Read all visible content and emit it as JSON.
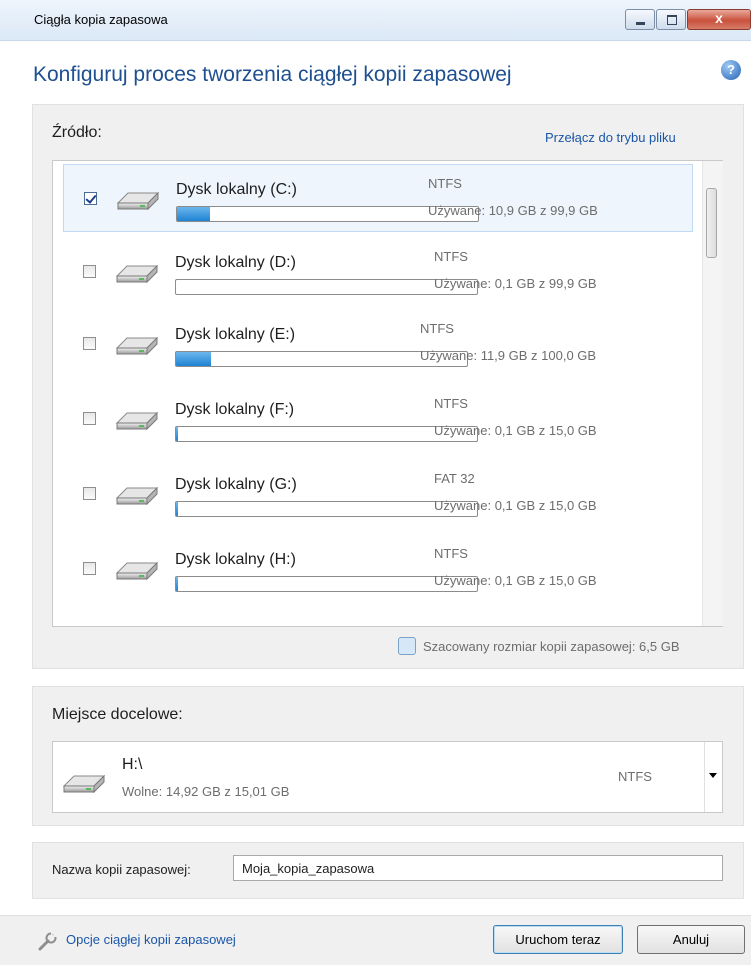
{
  "window": {
    "title": "Ciągła kopia zapasowa",
    "close_glyph": "x"
  },
  "heading": "Konfiguruj proces tworzenia ciągłej kopii zapasowej",
  "help_glyph": "?",
  "source": {
    "label": "Źródło:",
    "switch_link": "Przełącz do trybu pliku",
    "disks": [
      {
        "name": "Dysk lokalny (C:)",
        "fs": "NTFS",
        "used": "Używane: 10,9 GB z 99,9 GB",
        "checked": true,
        "usage": 0.109
      },
      {
        "name": "Dysk lokalny (D:)",
        "fs": "NTFS",
        "used": "Używane: 0,1 GB z 99,9 GB",
        "checked": false,
        "usage": 0.001
      },
      {
        "name": "Dysk lokalny (E:)",
        "fs": "NTFS",
        "used": "Używane: 11,9 GB z 100,0 GB",
        "checked": false,
        "usage": 0.119
      },
      {
        "name": "Dysk lokalny (F:)",
        "fs": "NTFS",
        "used": "Używane: 0,1 GB z 15,0 GB",
        "checked": false,
        "usage": 0.007
      },
      {
        "name": "Dysk lokalny (G:)",
        "fs": "FAT 32",
        "used": "Używane: 0,1 GB z 15,0 GB",
        "checked": false,
        "usage": 0.007
      },
      {
        "name": "Dysk lokalny (H:)",
        "fs": "NTFS",
        "used": "Używane: 0,1 GB z 15,0 GB",
        "checked": false,
        "usage": 0.007
      }
    ],
    "estimated_size": "Szacowany rozmiar kopii zapasowej: 6,5 GB"
  },
  "destination": {
    "label": "Miejsce docelowe:",
    "drive": "H:\\",
    "free": "Wolne: 14,92 GB z 15,01 GB",
    "fs": "NTFS"
  },
  "backup_name": {
    "label": "Nazwa kopii zapasowej:",
    "value": "Moja_kopia_zapasowa"
  },
  "footer": {
    "options_link": "Opcje ciągłej kopii zapasowej",
    "run_button": "Uruchom teraz",
    "cancel_button": "Anuluj"
  },
  "colors": {
    "accent_text": "#1d4f91",
    "link": "#1a56a8",
    "usage_bar": "#1f82d3"
  }
}
